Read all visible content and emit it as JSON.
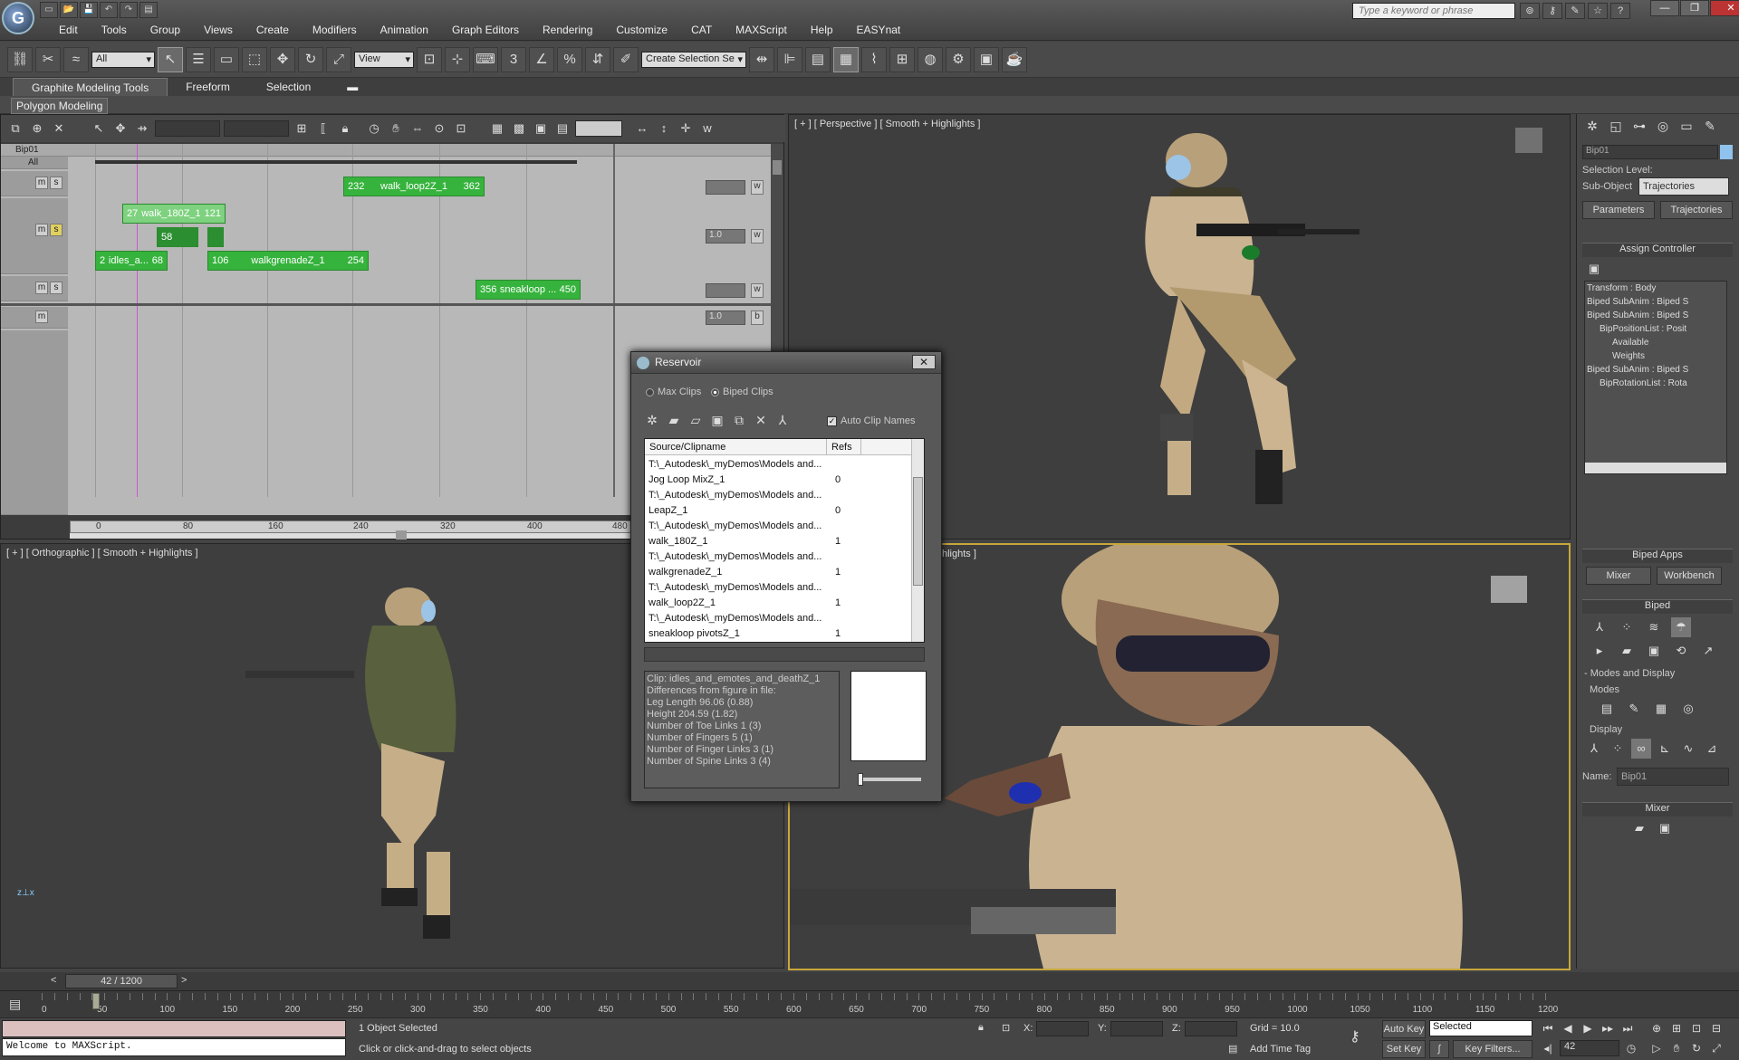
{
  "app": {
    "quick_access": [
      "▭",
      "📂",
      "💾",
      "↶",
      "↷",
      "▤"
    ],
    "menu": [
      "Edit",
      "Tools",
      "Group",
      "Views",
      "Create",
      "Modifiers",
      "Animation",
      "Graph Editors",
      "Rendering",
      "Customize",
      "CAT",
      "MAXScript",
      "Help",
      "EASYnat"
    ],
    "search_placeholder": "Type a keyword or phrase",
    "window_controls": [
      "—",
      "❐",
      "✕"
    ]
  },
  "toolbar": {
    "selection_filter": "All",
    "ref_coord": "View",
    "named_selection": "Create Selection Se"
  },
  "ribbon": {
    "tabs": [
      "Graphite Modeling Tools",
      "Freeform",
      "Selection"
    ],
    "sub_label": "Polygon Modeling"
  },
  "mixer": {
    "root": "Bip01",
    "all_label": "All",
    "tracks": [
      {
        "clips": [
          {
            "start": "232",
            "name": "walk_loop2Z_1",
            "end": "362"
          }
        ],
        "weight": "",
        "btn": "w"
      },
      {
        "clips": [
          {
            "start": "27",
            "name": "walk_180Z_1",
            "end": "121"
          },
          {
            "start": "2",
            "name": "idles_a...",
            "end": "68"
          },
          {
            "start": "106",
            "name": "walkgrenadeZ_1",
            "end": "254"
          }
        ],
        "transition": "58",
        "weight": "1.0",
        "btn": "w"
      },
      {
        "clips": [
          {
            "start": "356",
            "name": "sneakloop ...",
            "end": "450"
          }
        ],
        "weight": "",
        "btn": "w"
      },
      {
        "weight": "1.0",
        "btn": "b"
      }
    ],
    "ruler": [
      "0",
      "80",
      "160",
      "240",
      "320",
      "400",
      "480"
    ]
  },
  "viewports": {
    "perspective": "[ + ] [ Perspective ] [ Smooth + Highlights ]",
    "orthographic": "[ + ] [ Orthographic ] [ Smooth + Highlights ]",
    "camera_partial": "hlights ]"
  },
  "reservoir": {
    "title": "Reservoir",
    "radio_max": "Max Clips",
    "radio_biped": "Biped Clips",
    "auto_clip_names": "Auto Clip Names",
    "col_source": "Source/Clipname",
    "col_refs": "Refs",
    "rows": [
      {
        "text": "T:\\_Autodesk\\_myDemos\\Models and...",
        "ref": ""
      },
      {
        "text": "   Jog Loop MixZ_1",
        "ref": "0"
      },
      {
        "text": "T:\\_Autodesk\\_myDemos\\Models and...",
        "ref": ""
      },
      {
        "text": "   LeapZ_1",
        "ref": "0"
      },
      {
        "text": "T:\\_Autodesk\\_myDemos\\Models and...",
        "ref": ""
      },
      {
        "text": "   walk_180Z_1",
        "ref": "1"
      },
      {
        "text": "T:\\_Autodesk\\_myDemos\\Models and...",
        "ref": ""
      },
      {
        "text": "   walkgrenadeZ_1",
        "ref": "1"
      },
      {
        "text": "T:\\_Autodesk\\_myDemos\\Models and...",
        "ref": ""
      },
      {
        "text": "   walk_loop2Z_1",
        "ref": "1"
      },
      {
        "text": "T:\\_Autodesk\\_myDemos\\Models and...",
        "ref": ""
      },
      {
        "text": "   sneakloop pivotsZ_1",
        "ref": "1"
      }
    ],
    "info": [
      "Clip: idles_and_emotes_and_deathZ_1",
      "   Differences from figure in file:",
      "      Leg Length 96.06 (0.88)",
      "      Height 204.59 (1.82)",
      "      Number of Toe Links 1 (3)",
      "      Number of Fingers 5 (1)",
      "      Number of Finger Links 3 (1)",
      "      Number of Spine Links 3 (4)"
    ]
  },
  "command_panel": {
    "object_name": "Bip01",
    "selection_level": "Selection Level:",
    "sub_object_label": "Sub-Object",
    "sub_object_value": "Trajectories",
    "btn_parameters": "Parameters",
    "btn_trajectories": "Trajectories",
    "assign_controller": "Assign Controller",
    "tree": [
      {
        "text": "Transform : Body",
        "indent": 0
      },
      {
        "text": "Biped SubAnim : Biped S",
        "indent": 0
      },
      {
        "text": "Biped SubAnim : Biped S",
        "indent": 0
      },
      {
        "text": "BipPositionList : Posit",
        "indent": 1
      },
      {
        "text": "Available",
        "indent": 2
      },
      {
        "text": "Weights",
        "indent": 2
      },
      {
        "text": "Biped SubAnim : Biped S",
        "indent": 0
      },
      {
        "text": "BipRotationList : Rota",
        "indent": 1
      }
    ],
    "biped_apps": "Biped Apps",
    "btn_mixer": "Mixer",
    "btn_workbench": "Workbench",
    "biped": "Biped",
    "modes_display": "- Modes and Display",
    "modes": "Modes",
    "display": "Display",
    "name_label": "Name:",
    "name_value": "Bip01",
    "mixer": "Mixer"
  },
  "timebar": {
    "slider": "42 / 1200",
    "ticks": [
      "0",
      "50",
      "100",
      "150",
      "200",
      "250",
      "300",
      "350",
      "400",
      "450",
      "500",
      "550",
      "600",
      "650",
      "700",
      "750",
      "800",
      "850",
      "900",
      "950",
      "1000",
      "1050",
      "1100",
      "1150",
      "1200"
    ]
  },
  "status": {
    "maxscript": "Welcome to MAXScript.",
    "objects_selected": "1 Object Selected",
    "prompt": "Click or click-and-drag to select objects",
    "x": "X:",
    "y": "Y:",
    "z": "Z:",
    "grid": "Grid = 10.0",
    "add_time_tag": "Add Time Tag",
    "auto_key": "Auto Key",
    "set_key": "Set Key",
    "selected": "Selected",
    "key_filters": "Key Filters...",
    "frame": "42"
  }
}
